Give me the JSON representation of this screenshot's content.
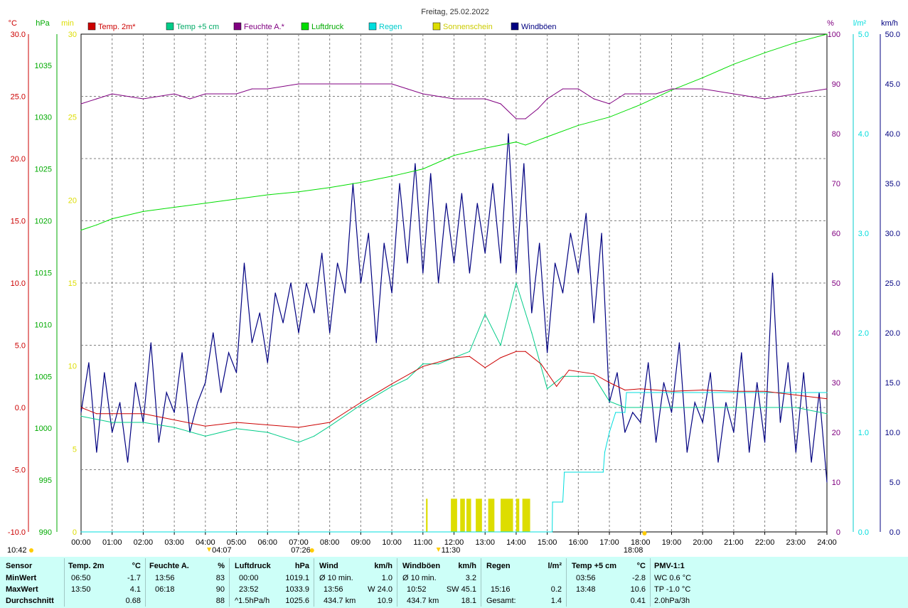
{
  "chart_data": {
    "type": "line",
    "title": "Freitag, 25.02.2022",
    "x_ticks": [
      "00:00",
      "01:00",
      "02:00",
      "03:00",
      "04:00",
      "05:00",
      "06:00",
      "07:00",
      "08:00",
      "09:00",
      "10:00",
      "11:00",
      "12:00",
      "13:00",
      "14:00",
      "15:00",
      "16:00",
      "17:00",
      "18:00",
      "19:00",
      "20:00",
      "21:00",
      "22:00",
      "23:00",
      "24:00"
    ],
    "axes": {
      "temp": {
        "unit": "°C",
        "min": -10,
        "max": 30,
        "color": "#cc0000",
        "ticks": [
          "-10.0",
          "-5.0",
          "0.0",
          "5.0",
          "10.0",
          "15.0",
          "20.0",
          "25.0",
          "30.0"
        ]
      },
      "pressure": {
        "unit": "hPa",
        "min": 990,
        "max": 1038,
        "color": "#00aa00",
        "ticks": [
          "990",
          "995",
          "1000",
          "1005",
          "1010",
          "1015",
          "1020",
          "1025",
          "1030",
          "1035"
        ]
      },
      "sunshine": {
        "unit": "min",
        "min": 0,
        "max": 30,
        "color": "#dddd00",
        "ticks": [
          "0",
          "5",
          "10",
          "15",
          "20",
          "25",
          "30"
        ]
      },
      "humidity": {
        "unit": "%",
        "min": 0,
        "max": 100,
        "color": "#800080",
        "ticks": [
          "0",
          "10",
          "20",
          "30",
          "40",
          "50",
          "60",
          "70",
          "80",
          "90",
          "100"
        ]
      },
      "rain": {
        "unit": "l/m²",
        "min": 0,
        "max": 5,
        "color": "#00dddd",
        "ticks": [
          "0.0",
          "1.0",
          "2.0",
          "3.0",
          "4.0",
          "5.0"
        ]
      },
      "wind": {
        "unit": "km/h",
        "min": 0,
        "max": 50,
        "color": "#000080",
        "ticks": [
          "0.0",
          "5.0",
          "10.0",
          "15.0",
          "20.0",
          "25.0",
          "30.0",
          "35.0",
          "40.0",
          "45.0",
          "50.0"
        ]
      }
    },
    "legend": [
      {
        "name": "Temp. 2m*",
        "color": "#cc0000"
      },
      {
        "name": "Temp +5 cm",
        "color": "#00cc88"
      },
      {
        "name": "Feuchte A.*",
        "color": "#800080"
      },
      {
        "name": "Luftdruck",
        "color": "#00dd00"
      },
      {
        "name": "Regen",
        "color": "#00dddd"
      },
      {
        "name": "Sonnenschein",
        "color": "#dddd00"
      },
      {
        "name": "Windböen",
        "color": "#000080"
      }
    ],
    "series": [
      {
        "name": "Temp. 2m*",
        "axis": "temp",
        "x": [
          0,
          0.5,
          1,
          2,
          3,
          4,
          5,
          6,
          7,
          8,
          9,
          10,
          11,
          12,
          12.5,
          13,
          13.5,
          14,
          14.3,
          14.8,
          15.3,
          15.7,
          16.5,
          17,
          17.5,
          18,
          19,
          20,
          21,
          22,
          23,
          24
        ],
        "values": [
          0,
          -0.5,
          -0.5,
          -0.5,
          -1,
          -1.5,
          -1.2,
          -1.4,
          -1.6,
          -1.2,
          0.4,
          1.9,
          3.3,
          4,
          4.1,
          3.2,
          4,
          4.5,
          4.5,
          3.5,
          1.7,
          3,
          2.7,
          2,
          1.4,
          1.5,
          1.3,
          1.4,
          1.3,
          1.3,
          1,
          0.7
        ]
      },
      {
        "name": "Temp +5 cm",
        "axis": "temp",
        "x": [
          0,
          1,
          2,
          3,
          4,
          4.5,
          5,
          6,
          7,
          7.5,
          8,
          9,
          10,
          10.5,
          11,
          11.5,
          12,
          12.5,
          13,
          13.5,
          14,
          14.5,
          15,
          15.5,
          16,
          16.5,
          17,
          17.5,
          18,
          19,
          20,
          21,
          22,
          23,
          24
        ],
        "values": [
          -0.7,
          -1.2,
          -1.2,
          -1.6,
          -2.3,
          -2,
          -1.7,
          -2,
          -2.8,
          -2.3,
          -1.5,
          0.2,
          1.7,
          2.3,
          3.5,
          3.5,
          4,
          4.5,
          7.5,
          5,
          10,
          6,
          1.5,
          2.5,
          2.5,
          2.5,
          0.5,
          0,
          0,
          0,
          0,
          0,
          0,
          0,
          -0.5
        ]
      },
      {
        "name": "Feuchte A.*",
        "axis": "humidity",
        "x": [
          0,
          0.5,
          1,
          2,
          3,
          3.5,
          4,
          5,
          5.5,
          6,
          7,
          8,
          9,
          10,
          10.5,
          11,
          12,
          13,
          13.5,
          14,
          14.3,
          14.7,
          15,
          15.5,
          16,
          16.5,
          17,
          17.5,
          18,
          18.5,
          19,
          20,
          21,
          22,
          23,
          24
        ],
        "values": [
          86,
          87,
          88,
          87,
          88,
          87,
          88,
          88,
          89,
          89,
          90,
          90,
          90,
          90,
          89,
          88,
          87,
          87,
          86,
          83,
          83,
          85,
          87,
          89,
          89,
          87,
          86,
          88,
          88,
          88,
          89,
          89,
          88,
          87,
          88,
          89
        ]
      },
      {
        "name": "Luftdruck",
        "axis": "pressure",
        "x": [
          0,
          0.5,
          1,
          2,
          3,
          4,
          5,
          6,
          7,
          8,
          9,
          10,
          11,
          12,
          13,
          14,
          14.3,
          15,
          16,
          17,
          18,
          19,
          20,
          21,
          22,
          23,
          24
        ],
        "values": [
          1019.1,
          1019.6,
          1020.2,
          1020.9,
          1021.3,
          1021.7,
          1022.1,
          1022.5,
          1022.8,
          1023.2,
          1023.7,
          1024.3,
          1025,
          1026.3,
          1027,
          1027.6,
          1027.3,
          1028.1,
          1029.2,
          1030,
          1031.2,
          1032.6,
          1033.8,
          1035.1,
          1036.2,
          1037.2,
          1038
        ]
      },
      {
        "name": "Regen",
        "axis": "rain",
        "x": [
          0,
          15.16,
          15.17,
          15.5,
          15.55,
          16.8,
          16.85,
          17,
          17.2,
          17.5,
          17.55,
          24
        ],
        "values": [
          0,
          0,
          0.3,
          0.3,
          0.6,
          0.6,
          0.8,
          1.0,
          1.2,
          1.2,
          1.4,
          1.4
        ]
      },
      {
        "name": "Sonnenschein",
        "axis": "sunshine",
        "bars": [
          [
            11.1,
            11.15,
            2
          ],
          [
            11.9,
            12.1,
            2
          ],
          [
            12.2,
            12.35,
            2
          ],
          [
            12.4,
            12.55,
            2
          ],
          [
            12.7,
            12.9,
            2
          ],
          [
            13.1,
            13.3,
            2
          ],
          [
            13.5,
            13.9,
            2
          ],
          [
            14.0,
            14.1,
            2
          ],
          [
            14.2,
            14.45,
            2
          ]
        ]
      },
      {
        "name": "Windböen",
        "axis": "wind",
        "x": [
          0,
          0.25,
          0.5,
          0.75,
          1,
          1.25,
          1.5,
          1.75,
          2,
          2.25,
          2.5,
          2.75,
          3,
          3.25,
          3.5,
          3.75,
          4,
          4.25,
          4.5,
          4.75,
          5,
          5.25,
          5.5,
          5.75,
          6,
          6.25,
          6.5,
          6.75,
          7,
          7.25,
          7.5,
          7.75,
          8,
          8.25,
          8.5,
          8.75,
          9,
          9.25,
          9.5,
          9.75,
          10,
          10.25,
          10.5,
          10.75,
          11,
          11.25,
          11.5,
          11.75,
          12,
          12.25,
          12.5,
          12.75,
          13,
          13.25,
          13.5,
          13.75,
          14,
          14.25,
          14.5,
          14.75,
          15,
          15.25,
          15.5,
          15.75,
          16,
          16.25,
          16.5,
          16.75,
          17,
          17.25,
          17.5,
          17.75,
          18,
          18.25,
          18.5,
          18.75,
          19,
          19.25,
          19.5,
          19.75,
          20,
          20.25,
          20.5,
          20.75,
          21,
          21.25,
          21.5,
          21.75,
          22,
          22.25,
          22.5,
          22.75,
          23,
          23.25,
          23.5,
          23.75,
          24
        ],
        "values": [
          12,
          17,
          8,
          16,
          10,
          13,
          7,
          15,
          11,
          19,
          9,
          14,
          12,
          18,
          10,
          13,
          15,
          20,
          14,
          18,
          16,
          27,
          19,
          22,
          17,
          24,
          21,
          25,
          20,
          25,
          22,
          28,
          20,
          27,
          24,
          35,
          25,
          30,
          19,
          29,
          24,
          35,
          27,
          37,
          26,
          36,
          25,
          33,
          27,
          34,
          26,
          33,
          28,
          35,
          27,
          40,
          26,
          37,
          22,
          29,
          18,
          27,
          24,
          30,
          26,
          32,
          21,
          30,
          13,
          16,
          10,
          12,
          11,
          17,
          9,
          15,
          12,
          19,
          8,
          13,
          11,
          16,
          7,
          13,
          10,
          18,
          8,
          15,
          9,
          26,
          11,
          17,
          8,
          16,
          7,
          14,
          5
        ]
      }
    ]
  },
  "stats": {
    "headers": [
      "Sensor",
      "Temp. 2m",
      "°C",
      "Feuchte A.",
      "%",
      "Luftdruck",
      "hPa",
      "Wind",
      "km/h",
      "Windböen",
      "km/h",
      "Regen",
      "l/m²",
      "Temp +5 cm",
      "°C",
      "PMV-1:1"
    ],
    "rows": [
      {
        "label": "MinWert",
        "t2_time": "06:50",
        "t2_val": "-1.7",
        "fe_time": "13:56",
        "fe_val": "83",
        "lu_time": "00:00",
        "lu_val": "1019.1",
        "wi_time": "Ø 10 min.",
        "wi_val": "1.0",
        "wb_time": "Ø 10 min.",
        "wb_val": "3.2",
        "re_time": "",
        "re_val": "",
        "t5_time": "03:56",
        "t5_val": "-2.8",
        "pmv": "WC 0.6 °C"
      },
      {
        "label": "MaxWert",
        "t2_time": "13:50",
        "t2_val": "4.1",
        "fe_time": "06:18",
        "fe_val": "90",
        "lu_time": "23:52",
        "lu_val": "1033.9",
        "wi_time": "13:56",
        "wi_val": "W 24.0",
        "wb_time": "10:52",
        "wb_val": "SW 45.1",
        "re_time": "15:16",
        "re_val": "0.2",
        "t5_time": "13:48",
        "t5_val": "10.6",
        "pmv": "TP -1.0 °C"
      },
      {
        "label": "Durchschnitt",
        "t2_time": "",
        "t2_val": "0.68",
        "fe_time": "",
        "fe_val": "88",
        "lu_time": "^1.5hPa/h",
        "lu_val": "1025.6",
        "wi_time": "434.7 km",
        "wi_val": "10.9",
        "wb_time": "434.7 km",
        "wb_val": "18.1",
        "re_time": "Gesamt:",
        "re_val": "1.4",
        "t5_time": "",
        "t5_val": "0.41",
        "pmv": "2.0hPa/3h"
      }
    ]
  },
  "markers": {
    "time_left": "10:42",
    "sunrise": "04:07",
    "dawn": "07:26",
    "noon": "11:30",
    "sunset": "18:08"
  }
}
